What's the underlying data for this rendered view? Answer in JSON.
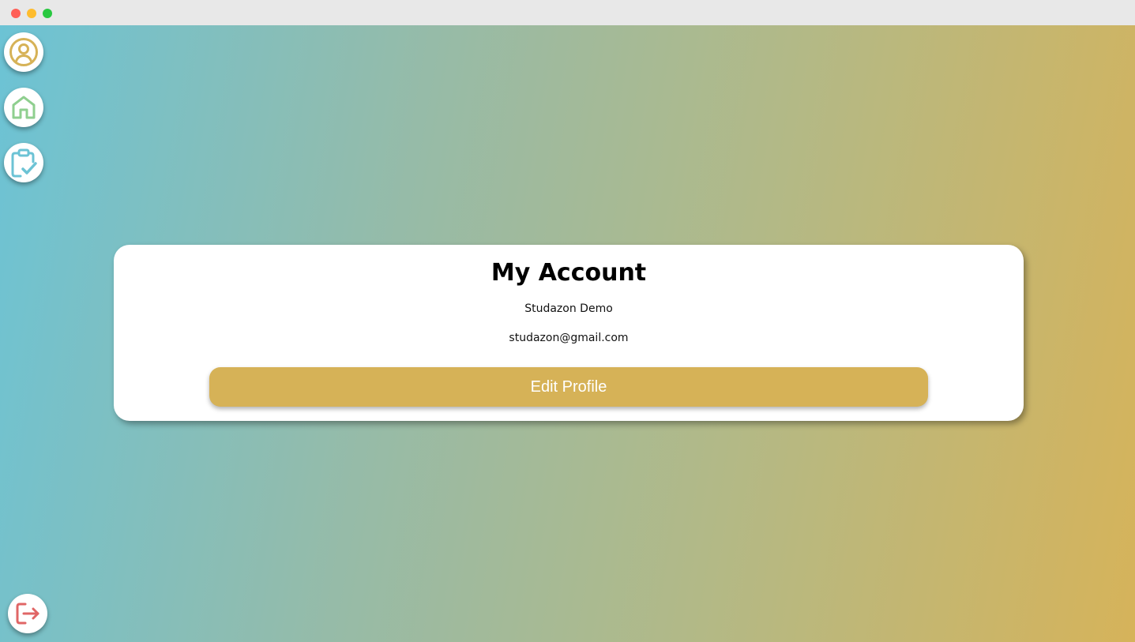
{
  "window": {
    "controls": [
      "close",
      "minimize",
      "maximize"
    ]
  },
  "sidebar": {
    "items": [
      {
        "name": "profile",
        "icon": "user-circle-icon",
        "color": "#d6b257"
      },
      {
        "name": "home",
        "icon": "home-icon",
        "color": "#8fcf8f"
      },
      {
        "name": "tasks",
        "icon": "clipboard-check-icon",
        "color": "#6cc3d5"
      }
    ],
    "logout": {
      "icon": "logout-icon",
      "color": "#e06666"
    }
  },
  "account": {
    "title": "My Account",
    "name": "Studazon Demo",
    "email": "studazon@gmail.com",
    "edit_label": "Edit Profile"
  },
  "colors": {
    "accent": "#d6b257",
    "gradient_start": "#6cc3d5",
    "gradient_end": "#d6b35a"
  }
}
